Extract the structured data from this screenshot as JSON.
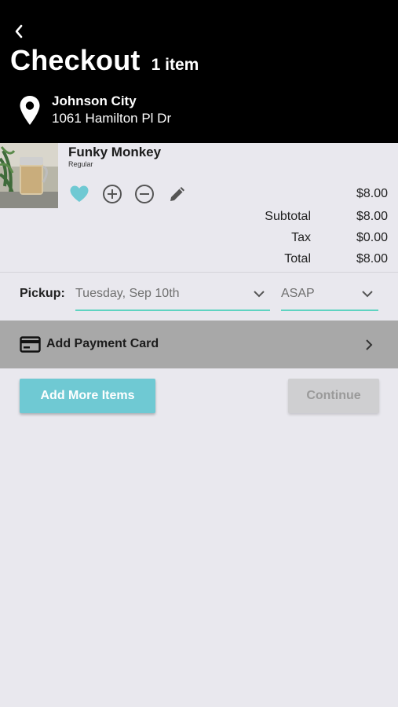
{
  "header": {
    "title": "Checkout",
    "item_count": "1 item",
    "location_name": "Johnson City",
    "location_address": "1061 Hamilton Pl Dr"
  },
  "cart": {
    "items": [
      {
        "name": "Funky Monkey",
        "variant": "Regular",
        "price": "$8.00",
        "favorite": true
      }
    ]
  },
  "totals": {
    "subtotal_label": "Subtotal",
    "subtotal_value": "$8.00",
    "tax_label": "Tax",
    "tax_value": "$0.00",
    "total_label": "Total",
    "total_value": "$8.00"
  },
  "pickup": {
    "label": "Pickup:",
    "date": "Tuesday, Sep 10th",
    "time": "ASAP"
  },
  "payment": {
    "label": "Add Payment Card"
  },
  "actions": {
    "add_more_label": "Add More Items",
    "continue_label": "Continue"
  },
  "colors": {
    "accent": "#6fc9d3",
    "underline": "#5fd3c1",
    "header_bg": "#000000",
    "page_bg": "#e9e8ee"
  },
  "icons": [
    "back-chevron-icon",
    "location-pin-icon",
    "heart-icon",
    "plus-circle-icon",
    "minus-circle-icon",
    "pencil-icon",
    "chevron-down-icon",
    "credit-card-icon",
    "chevron-right-icon"
  ]
}
